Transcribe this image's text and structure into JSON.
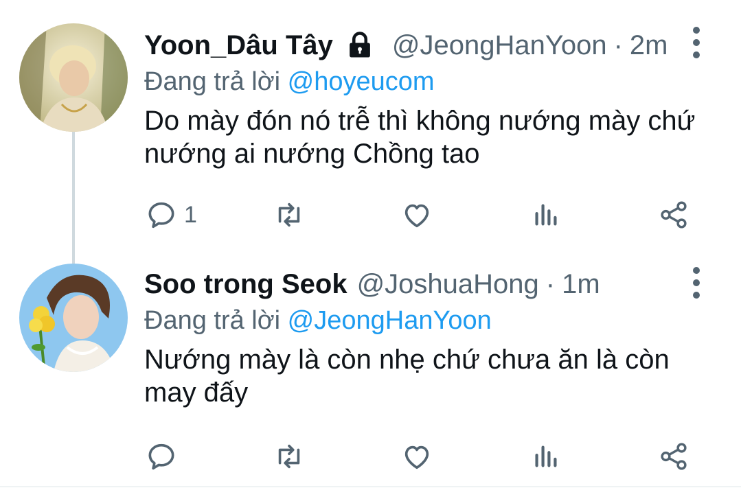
{
  "tweets": [
    {
      "display_name": "Yoon_Dâu Tây",
      "protected_icon": "lock-icon",
      "handle": "@JeongHanYoon",
      "separator": "·",
      "time": "2m",
      "reply_prefix": "Đang trả lời",
      "reply_mention": "@hoyeucom",
      "text_line1": "Do mày đón nó trễ thì không nướng mày chứ",
      "text_line2": "nướng ai nướng Chồng tao",
      "reply_count": "1",
      "icons": [
        "reply-icon",
        "retweet-icon",
        "like-icon",
        "analytics-icon",
        "share-icon",
        "more-options-icon"
      ]
    },
    {
      "display_name": "Soo trong Seok",
      "handle": "@JoshuaHong",
      "separator": "·",
      "time": "1m",
      "reply_prefix": "Đang trả lời",
      "reply_mention": "@JeongHanYoon",
      "text_line1": "Nướng mày là còn nhẹ chứ chưa ăn là còn",
      "text_line2": "may đấy",
      "reply_count": "",
      "icons": [
        "reply-icon",
        "retweet-icon",
        "like-icon",
        "analytics-icon",
        "share-icon",
        "more-options-icon"
      ]
    }
  ],
  "colors": {
    "text_primary": "#0f1419",
    "text_secondary": "#536471",
    "link": "#1d9bf0",
    "thread_line": "#cfd9de"
  }
}
